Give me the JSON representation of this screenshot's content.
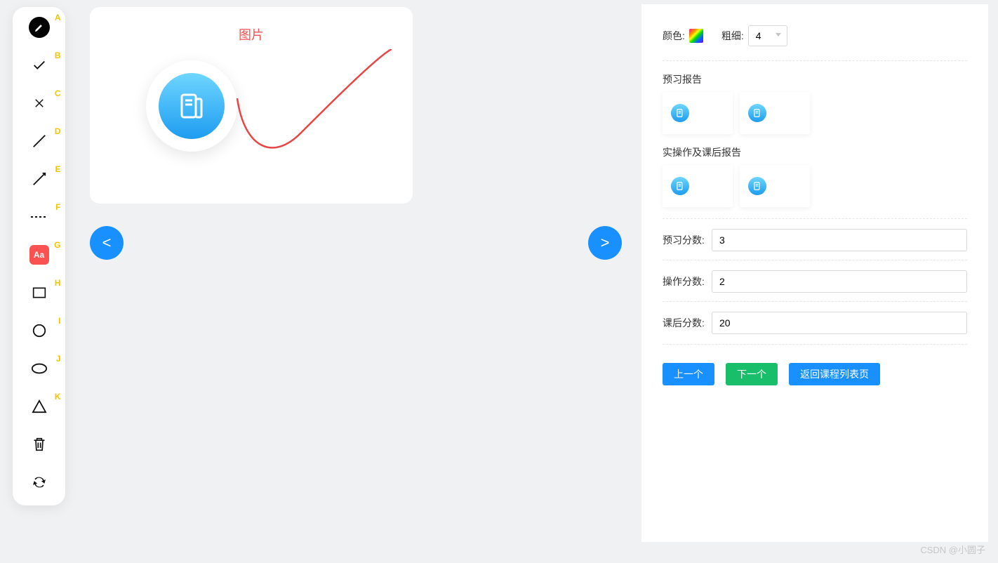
{
  "toolbar": {
    "items": [
      {
        "name": "pen-tool",
        "label": "A",
        "active": true
      },
      {
        "name": "check-tool",
        "label": "B"
      },
      {
        "name": "x-tool",
        "label": "C"
      },
      {
        "name": "line-tool",
        "label": "D"
      },
      {
        "name": "arrow-line-tool",
        "label": "E"
      },
      {
        "name": "dashed-line-tool",
        "label": "F"
      },
      {
        "name": "text-tool",
        "label": "G",
        "badge": "Aa"
      },
      {
        "name": "rect-tool",
        "label": "H"
      },
      {
        "name": "circle-tool",
        "label": "I"
      },
      {
        "name": "ellipse-tool",
        "label": "J"
      },
      {
        "name": "triangle-tool",
        "label": "K"
      },
      {
        "name": "trash-tool"
      },
      {
        "name": "sync-tool"
      }
    ]
  },
  "canvas": {
    "title": "图片"
  },
  "nav": {
    "prev": "<",
    "next": ">"
  },
  "panel": {
    "color_label": "颜色:",
    "thickness_label": "粗细:",
    "thickness_value": "4",
    "section_preview": "预习报告",
    "section_practice": "实操作及课后报告",
    "score_preview_label": "预习分数:",
    "score_preview_value": "3",
    "score_operate_label": "操作分数:",
    "score_operate_value": "2",
    "score_after_label": "课后分数:",
    "score_after_value": "20",
    "btn_prev": "上一个",
    "btn_next": "下一个",
    "btn_back": "返回课程列表页"
  },
  "watermark": "CSDN @小圆子"
}
